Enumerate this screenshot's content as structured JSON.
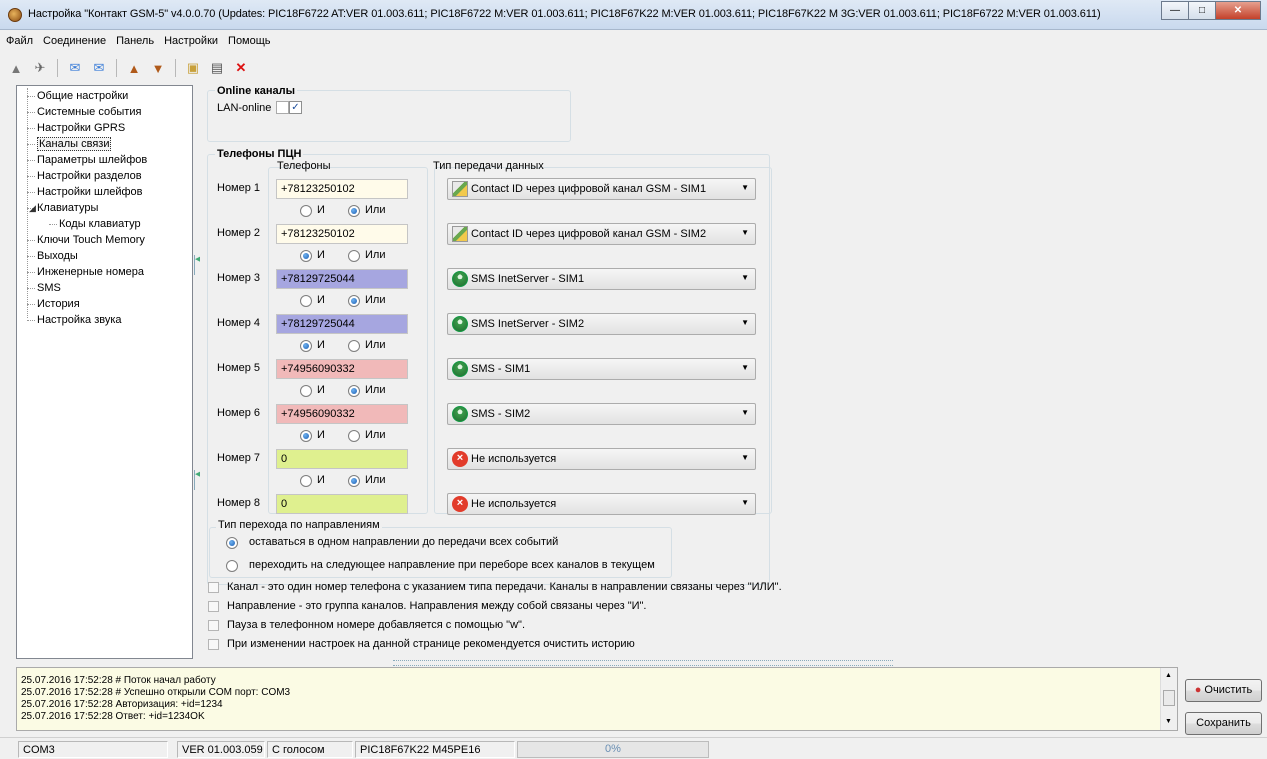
{
  "window": {
    "title": "Настройка \"Контакт GSM-5\" v4.0.0.70 (Updates: PIC18F6722 AT:VER 01.003.611; PIC18F6722 M:VER 01.003.611; PIC18F67K22 M:VER 01.003.611; PIC18F67K22 M 3G:VER 01.003.611; PIC18F6722 M:VER 01.003.611)"
  },
  "menu": [
    "Файл",
    "Соединение",
    "Панель",
    "Настройки",
    "Помощь"
  ],
  "tree": {
    "items": [
      {
        "label": "Общие настройки"
      },
      {
        "label": "Системные события"
      },
      {
        "label": "Настройки GPRS"
      },
      {
        "label": "Каналы связи"
      },
      {
        "label": "Параметры шлейфов"
      },
      {
        "label": "Настройки разделов"
      },
      {
        "label": "Настройки шлейфов"
      },
      {
        "label": "Клавиатуры"
      },
      {
        "label": "Коды клавиатур"
      },
      {
        "label": "Ключи Touch Memory"
      },
      {
        "label": "Выходы"
      },
      {
        "label": "Инженерные номера"
      },
      {
        "label": "SMS"
      },
      {
        "label": "История"
      },
      {
        "label": "Настройка звука"
      }
    ],
    "selected": "Каналы связи"
  },
  "online": {
    "title": "Online каналы",
    "lan_label": "LAN-online",
    "lan_checked": true
  },
  "phones": {
    "title": "Телефоны ПЦН",
    "col_phones": "Телефоны",
    "col_type": "Тип передачи данных",
    "and_label": "И",
    "or_label": "Или",
    "rows": [
      {
        "label": "Номер 1",
        "value": "+78123250102",
        "color": "#fffbea",
        "type": "Contact ID через цифровой канал GSM - SIM1",
        "icon": "contact-id-icon",
        "logic": "Или"
      },
      {
        "label": "Номер 2",
        "value": "+78123250102",
        "color": "#fffbea",
        "type": "Contact ID через цифровой канал GSM - SIM2",
        "icon": "contact-id-icon",
        "logic": "И"
      },
      {
        "label": "Номер 3",
        "value": "+78129725044",
        "color": "#a6a6e0",
        "type": "SMS InetServer - SIM1",
        "icon": "sms-icon",
        "logic": "Или"
      },
      {
        "label": "Номер 4",
        "value": "+78129725044",
        "color": "#a6a6e0",
        "type": "SMS InetServer - SIM2",
        "icon": "sms-icon",
        "logic": "И"
      },
      {
        "label": "Номер 5",
        "value": "+74956090332",
        "color": "#f1b9b9",
        "type": "SMS - SIM1",
        "icon": "sms-icon",
        "logic": "Или"
      },
      {
        "label": "Номер 6",
        "value": "+74956090332",
        "color": "#f1b9b9",
        "type": "SMS - SIM2",
        "icon": "sms-icon",
        "logic": "И"
      },
      {
        "label": "Номер 7",
        "value": "0",
        "color": "#dff08f",
        "type": "Не используется",
        "icon": "not-used-icon",
        "logic": "Или"
      },
      {
        "label": "Номер 8",
        "value": "0",
        "color": "#dff08f",
        "type": "Не используется",
        "icon": "not-used-icon",
        "logic": null
      }
    ]
  },
  "transition": {
    "title": "Тип перехода по направлениям",
    "options": [
      {
        "label": "оставаться в одном направлении до передачи всех событий",
        "selected": true
      },
      {
        "label": "переходить на следующее направление при переборе всех каналов в текущем",
        "selected": false
      }
    ]
  },
  "notes": [
    "Канал - это один номер телефона с указанием типа передачи. Каналы в направлении связаны через \"ИЛИ\".",
    "Направление - это группа каналов. Направления между собой связаны через \"И\".",
    "Пауза в телефонном номере добавляется с помощью \"w\".",
    "При изменении настроек на данной странице рекомендуется очистить историю"
  ],
  "log": [
    "25.07.2016 17:52:28  # Поток начал работу",
    "25.07.2016 17:52:28  # Успешно открыли COM порт: COM3",
    "25.07.2016 17:52:28 Авторизация: +id=1234",
    "25.07.2016 17:52:28 Ответ: +id=1234OK"
  ],
  "buttons": {
    "clear": "Очистить",
    "save": "Сохранить"
  },
  "status": {
    "port": "COM3",
    "version": "VER 01.003.059",
    "mode": "С голосом",
    "chip": "PIC18F67K22 M45PE16",
    "progress_text": "0%",
    "progress_value": 0
  }
}
